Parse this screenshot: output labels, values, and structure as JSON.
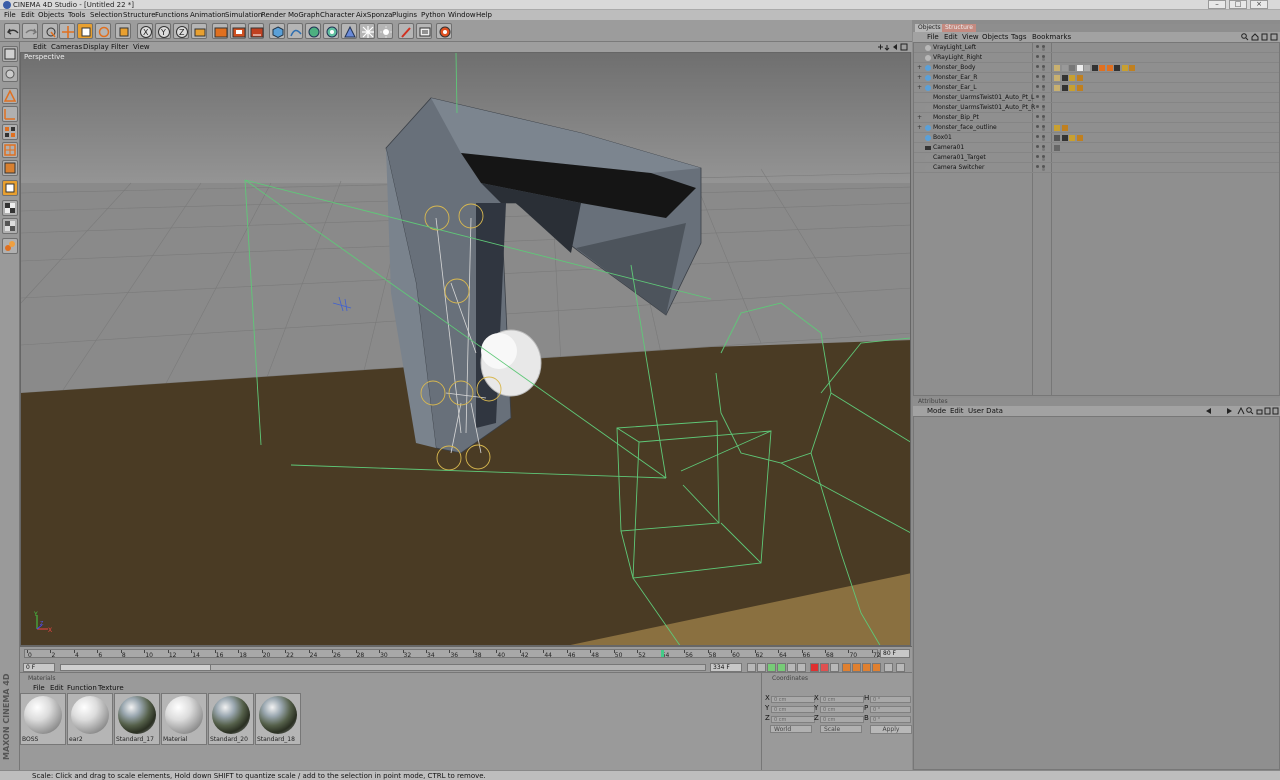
{
  "window": {
    "title": "CINEMA 4D Studio - [Untitled 22 *]",
    "buttons": [
      "–",
      "□",
      "×"
    ]
  },
  "menubar": [
    "File",
    "Edit",
    "Objects",
    "Tools",
    "Selection",
    "Structure",
    "Functions",
    "Animation",
    "Simulation",
    "Render",
    "MoGraph",
    "Character",
    "AixSponza",
    "Plugins",
    "Python",
    "Window",
    "Help"
  ],
  "toolbar": {
    "icons": [
      "undo-icon",
      "redo-icon",
      "live-select-icon",
      "move-icon",
      "scale-icon",
      "rotate-icon",
      "object-mode-icon",
      "x-axis-icon",
      "y-axis-icon",
      "z-axis-icon",
      "world-coord-icon",
      "render-view-icon",
      "render-picture-queue-icon",
      "render-settings-icon",
      "cube-icon",
      "spline-pen-icon",
      "nurbs-icon",
      "array-icon",
      "deformer-icon",
      "scene-icon",
      "light-icon",
      "camera-icon",
      "knife-icon",
      "render-icon",
      "grid-icon",
      "python-icon"
    ],
    "axis_labels": [
      "X",
      "Y",
      "Z"
    ]
  },
  "leftbar": {
    "icons": [
      "model-mode-icon",
      "object-tool-icon",
      "points-mode-icon",
      "edges-mode-icon",
      "polygons-mode-icon",
      "texture-mode-icon",
      "axis-mode-icon",
      "uv-mode-icon",
      "snap-icon",
      "texture-axis-icon",
      "sculpt-icon"
    ],
    "logo": "MAXON CINEMA 4D"
  },
  "viewport": {
    "menu": [
      "Edit",
      "Cameras",
      "Display",
      "Filter",
      "View"
    ],
    "label": "Perspective",
    "axis": {
      "x": "X",
      "y": "Y",
      "z": "Z"
    }
  },
  "timeline": {
    "ticks": [
      "0",
      "2",
      "4",
      "6",
      "8",
      "10",
      "12",
      "14",
      "16",
      "18",
      "20",
      "22",
      "24",
      "26",
      "28",
      "30",
      "32",
      "34",
      "36",
      "38",
      "40",
      "42",
      "44",
      "46",
      "48",
      "50",
      "52",
      "54",
      "56",
      "58",
      "60",
      "62",
      "64",
      "66",
      "68",
      "70",
      "72"
    ],
    "end_label": "80 F",
    "current_frame": "0 F",
    "max_frame": "334 F",
    "playhead_frame": 54
  },
  "materials": {
    "title": "Materials",
    "menu": [
      "File",
      "Edit",
      "Function",
      "Texture"
    ],
    "items": [
      {
        "label": "BOSS",
        "style": "white"
      },
      {
        "label": "ear2",
        "style": "white"
      },
      {
        "label": "Standard_17",
        "style": "chrome"
      },
      {
        "label": "Material",
        "style": "white"
      },
      {
        "label": "Standard_20",
        "style": "chrome"
      },
      {
        "label": "Standard_18",
        "style": "chrome"
      }
    ]
  },
  "coordinates": {
    "title": "Coordinates",
    "rows": [
      {
        "pos": "X",
        "pos_val": "0 cm",
        "size": "X",
        "size_val": "0 cm",
        "rot": "H",
        "rot_val": "0 °"
      },
      {
        "pos": "Y",
        "pos_val": "0 cm",
        "size": "Y",
        "size_val": "0 cm",
        "rot": "P",
        "rot_val": "0 °"
      },
      {
        "pos": "Z",
        "pos_val": "0 cm",
        "size": "Z",
        "size_val": "0 cm",
        "rot": "B",
        "rot_val": "0 °"
      }
    ],
    "mode_world": "World",
    "mode_scale": "Scale",
    "apply": "Apply"
  },
  "status": "Scale: Click and drag to scale elements, Hold down SHIFT to quantize scale / add to the selection in point mode, CTRL to remove.",
  "object_manager": {
    "tabs": [
      "Objects",
      "Structure"
    ],
    "menu": [
      "File",
      "Edit",
      "View",
      "Objects",
      "Tags",
      "Bookmarks"
    ],
    "objects": [
      {
        "name": "VrayLight_Left",
        "expand": "",
        "icon": "light",
        "tags": []
      },
      {
        "name": "VRayLight_Right",
        "expand": "",
        "icon": "light",
        "tags": []
      },
      {
        "name": "Monster_Body",
        "expand": "+",
        "icon": "poly",
        "tags": [
          "#c8b070",
          "#999",
          "#777",
          "#eee",
          "#aaa",
          "#333",
          "#e07020",
          "#e07020",
          "#333",
          "#c8a030",
          "#c08020"
        ]
      },
      {
        "name": "Monster_Ear_R",
        "expand": "+",
        "icon": "poly",
        "tags": [
          "#c8b070",
          "#333",
          "#c8a030",
          "#c08020"
        ]
      },
      {
        "name": "Monster_Ear_L",
        "expand": "+",
        "icon": "poly",
        "tags": [
          "#c8b070",
          "#333",
          "#c8a030",
          "#c08020"
        ]
      },
      {
        "name": "Monster_UarmsTwist01_Auto_Pt_L",
        "expand": "",
        "icon": "null",
        "tags": []
      },
      {
        "name": "Monster_UarmsTwist01_Auto_Pt_R",
        "expand": "",
        "icon": "null",
        "tags": []
      },
      {
        "name": "Monster_Bip_Pt",
        "expand": "+",
        "icon": "null",
        "tags": []
      },
      {
        "name": "Monster_face_outline",
        "expand": "+",
        "icon": "poly",
        "tags": [
          "#c8a030",
          "#c08020"
        ]
      },
      {
        "name": "Box01",
        "expand": "",
        "icon": "poly",
        "tags": [
          "#555",
          "#333",
          "#c8a030",
          "#c08020"
        ]
      },
      {
        "name": "Camera01",
        "expand": "",
        "icon": "camera",
        "tags": [
          "#666"
        ]
      },
      {
        "name": "Camera01_Target",
        "expand": "",
        "icon": "null",
        "tags": []
      },
      {
        "name": "Camera Switcher",
        "expand": "",
        "icon": "null",
        "tags": []
      }
    ]
  },
  "attributes": {
    "title": "Attributes",
    "menu": [
      "Mode",
      "Edit",
      "User Data"
    ]
  }
}
